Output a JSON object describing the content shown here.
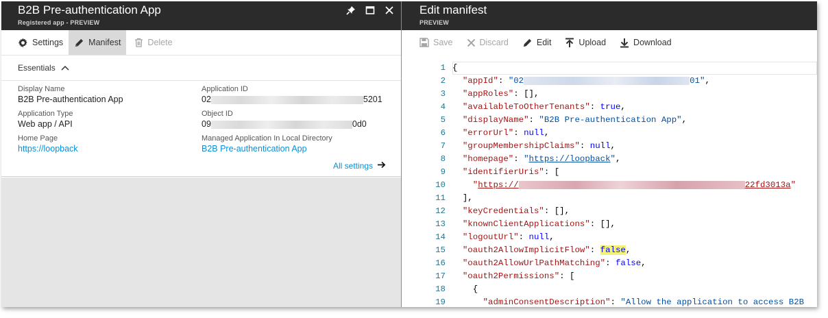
{
  "left_blade": {
    "title": "B2B Pre-authentication App",
    "subtitle": "Registered app - PREVIEW",
    "toolbar": {
      "settings_label": "Settings",
      "manifest_label": "Manifest",
      "delete_label": "Delete"
    },
    "essentials_label": "Essentials",
    "properties": {
      "display_name_label": "Display Name",
      "display_name_value": "B2B Pre-authentication App",
      "application_type_label": "Application Type",
      "application_type_value": "Web app / API",
      "home_page_label": "Home Page",
      "home_page_value": "https://loopback",
      "application_id_label": "Application ID",
      "application_id_prefix": "02",
      "application_id_suffix": "5201",
      "object_id_label": "Object ID",
      "object_id_prefix": "09",
      "object_id_suffix": "0d0",
      "managed_app_label": "Managed Application In Local Directory",
      "managed_app_value": "B2B Pre-authentication App"
    },
    "all_settings_label": "All settings"
  },
  "right_blade": {
    "title": "Edit manifest",
    "subtitle": "PREVIEW",
    "toolbar": {
      "save_label": "Save",
      "discard_label": "Discard",
      "edit_label": "Edit",
      "upload_label": "Upload",
      "download_label": "Download"
    },
    "manifest": {
      "line_numbers": [
        "1",
        "2",
        "3",
        "4",
        "5",
        "6",
        "7",
        "8",
        "9",
        "10",
        "11",
        "12",
        "13",
        "14",
        "15",
        "16",
        "17",
        "18",
        "19"
      ],
      "app_id_prefix": "\"02",
      "app_id_suffix": "01\"",
      "app_roles": "\"appRoles\": [],",
      "available_to_other_tenants": "\"availableToOtherTenants\": true,",
      "display_name": "\"displayName\": \"B2B Pre-authentication App\",",
      "error_url": "\"errorUrl\": null,",
      "group_membership_claims": "\"groupMembershipClaims\": null,",
      "homepage_key": "\"homepage\": ",
      "homepage_url": "https://loopback",
      "identifier_uris": "\"identifierUris\": [",
      "identifier_uri_prefix": "https://",
      "identifier_uri_suffix": "22fd3013a",
      "key_credentials": "\"keyCredentials\": [],",
      "known_client_applications": "\"knownClientApplications\": [],",
      "logout_url": "\"logoutUrl\": null,",
      "oauth2_allow_implicit_flow_key": "\"oauth2AllowImplicitFlow\": ",
      "oauth2_allow_implicit_flow_value": "false",
      "oauth2_allow_url_path_matching": "\"oauth2AllowUrlPathMatching\": false,",
      "oauth2_permissions": "\"oauth2Permissions\": [",
      "admin_consent_key": "\"adminConsentDescription\": ",
      "admin_consent_value": "\"Allow the application to access B2B"
    }
  },
  "colors": {
    "title_bar": "#2b2b2b",
    "link": "#0a8fd8",
    "highlight": "#f2f27a",
    "line_number": "#237893"
  }
}
